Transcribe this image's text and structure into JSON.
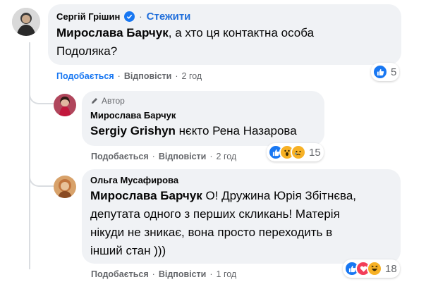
{
  "comments": [
    {
      "author": "Сергій Грішин",
      "verified": true,
      "follow_label": "Стежити",
      "mention": "Мирослава Барчук",
      "body_lines": [
        ", а хто ця контактна особа",
        "Подоляка?"
      ],
      "like_label": "Подобається",
      "reply_label": "Відповісти",
      "time": "2 год",
      "reaction_count": "5",
      "reactions": [
        "like-icon"
      ]
    },
    {
      "badge": "Автор",
      "author": "Мирослава Барчук",
      "mention": "Sergiy Grishyn",
      "body": " нєкто Рена Назарова",
      "like_label": "Подобається",
      "reply_label": "Відповісти",
      "time": "2 год",
      "reaction_count": "15",
      "reactions": [
        "like-icon",
        "wow-icon",
        "sad-icon"
      ]
    },
    {
      "author": "Ольга Мусафирова",
      "mention": "Мирослава Барчук",
      "body_lines": [
        " О! Дружина Юрія Збітнєва,",
        "депутата одного з перших скликань! Матерія",
        "нікуди не зникає, вона просто переходить в",
        "інший стан )))"
      ],
      "like_label": "Подобається",
      "reply_label": "Відповісти",
      "time": "1 год",
      "reaction_count": "18",
      "reactions": [
        "like-icon",
        "love-icon",
        "haha-icon"
      ]
    }
  ],
  "colors": {
    "bubble": "#f0f2f5",
    "link_blue": "#1877f2",
    "muted": "#65676b"
  }
}
